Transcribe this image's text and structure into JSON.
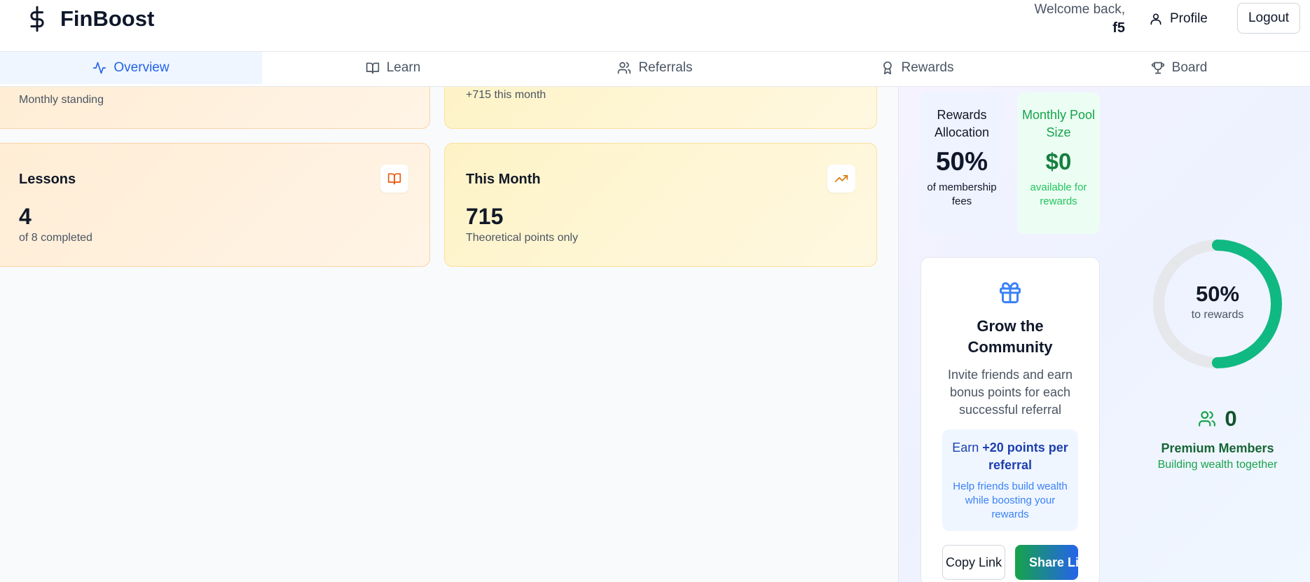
{
  "header": {
    "brand_name": "FinBoost",
    "brand_icon": "dollar-icon",
    "welcome_line": "Welcome back,",
    "username": "f5",
    "profile_label": "Profile",
    "logout_label": "Logout"
  },
  "tabs": [
    {
      "label": "Overview",
      "icon": "activity-icon",
      "active": true
    },
    {
      "label": "Learn",
      "icon": "book-open-icon",
      "active": false
    },
    {
      "label": "Referrals",
      "icon": "users-icon",
      "active": false
    },
    {
      "label": "Rewards",
      "icon": "award-icon",
      "active": false
    },
    {
      "label": "Board",
      "icon": "trophy-icon",
      "active": false
    }
  ],
  "stats": {
    "standing": {
      "subtitle": "Monthly standing"
    },
    "points": {
      "subtitle": "+715 this month"
    },
    "lessons": {
      "title": "Lessons",
      "value": "4",
      "subtitle": "of 8 completed",
      "icon": "book-open-icon"
    },
    "this_month": {
      "title": "This Month",
      "value": "715",
      "subtitle": "Theoretical points only",
      "icon": "trending-up-icon"
    }
  },
  "rewards_allocation": {
    "title": "Rewards Allocation",
    "value": "50%",
    "note": "of membership fees"
  },
  "monthly_pool": {
    "title": "Monthly Pool Size",
    "value": "$0",
    "note": "available for rewards"
  },
  "grow": {
    "icon": "gift-icon",
    "title": "Grow the Community",
    "description": "Invite friends and earn bonus points for each successful referral",
    "earn_prefix": "Earn ",
    "earn_bold": "+20 points per referral",
    "earn_note": "Help friends build wealth while boosting your rewards",
    "copy_label": "Copy Link",
    "share_label": "Share Link"
  },
  "donut": {
    "fraction": 0.5,
    "value_label": "50%",
    "sub_label": "to rewards",
    "fill_color": "#10b981",
    "track_color": "#e5e7eb"
  },
  "members": {
    "icon": "users-icon",
    "count": "0",
    "title": "Premium Members",
    "subtitle": "Building wealth together"
  }
}
